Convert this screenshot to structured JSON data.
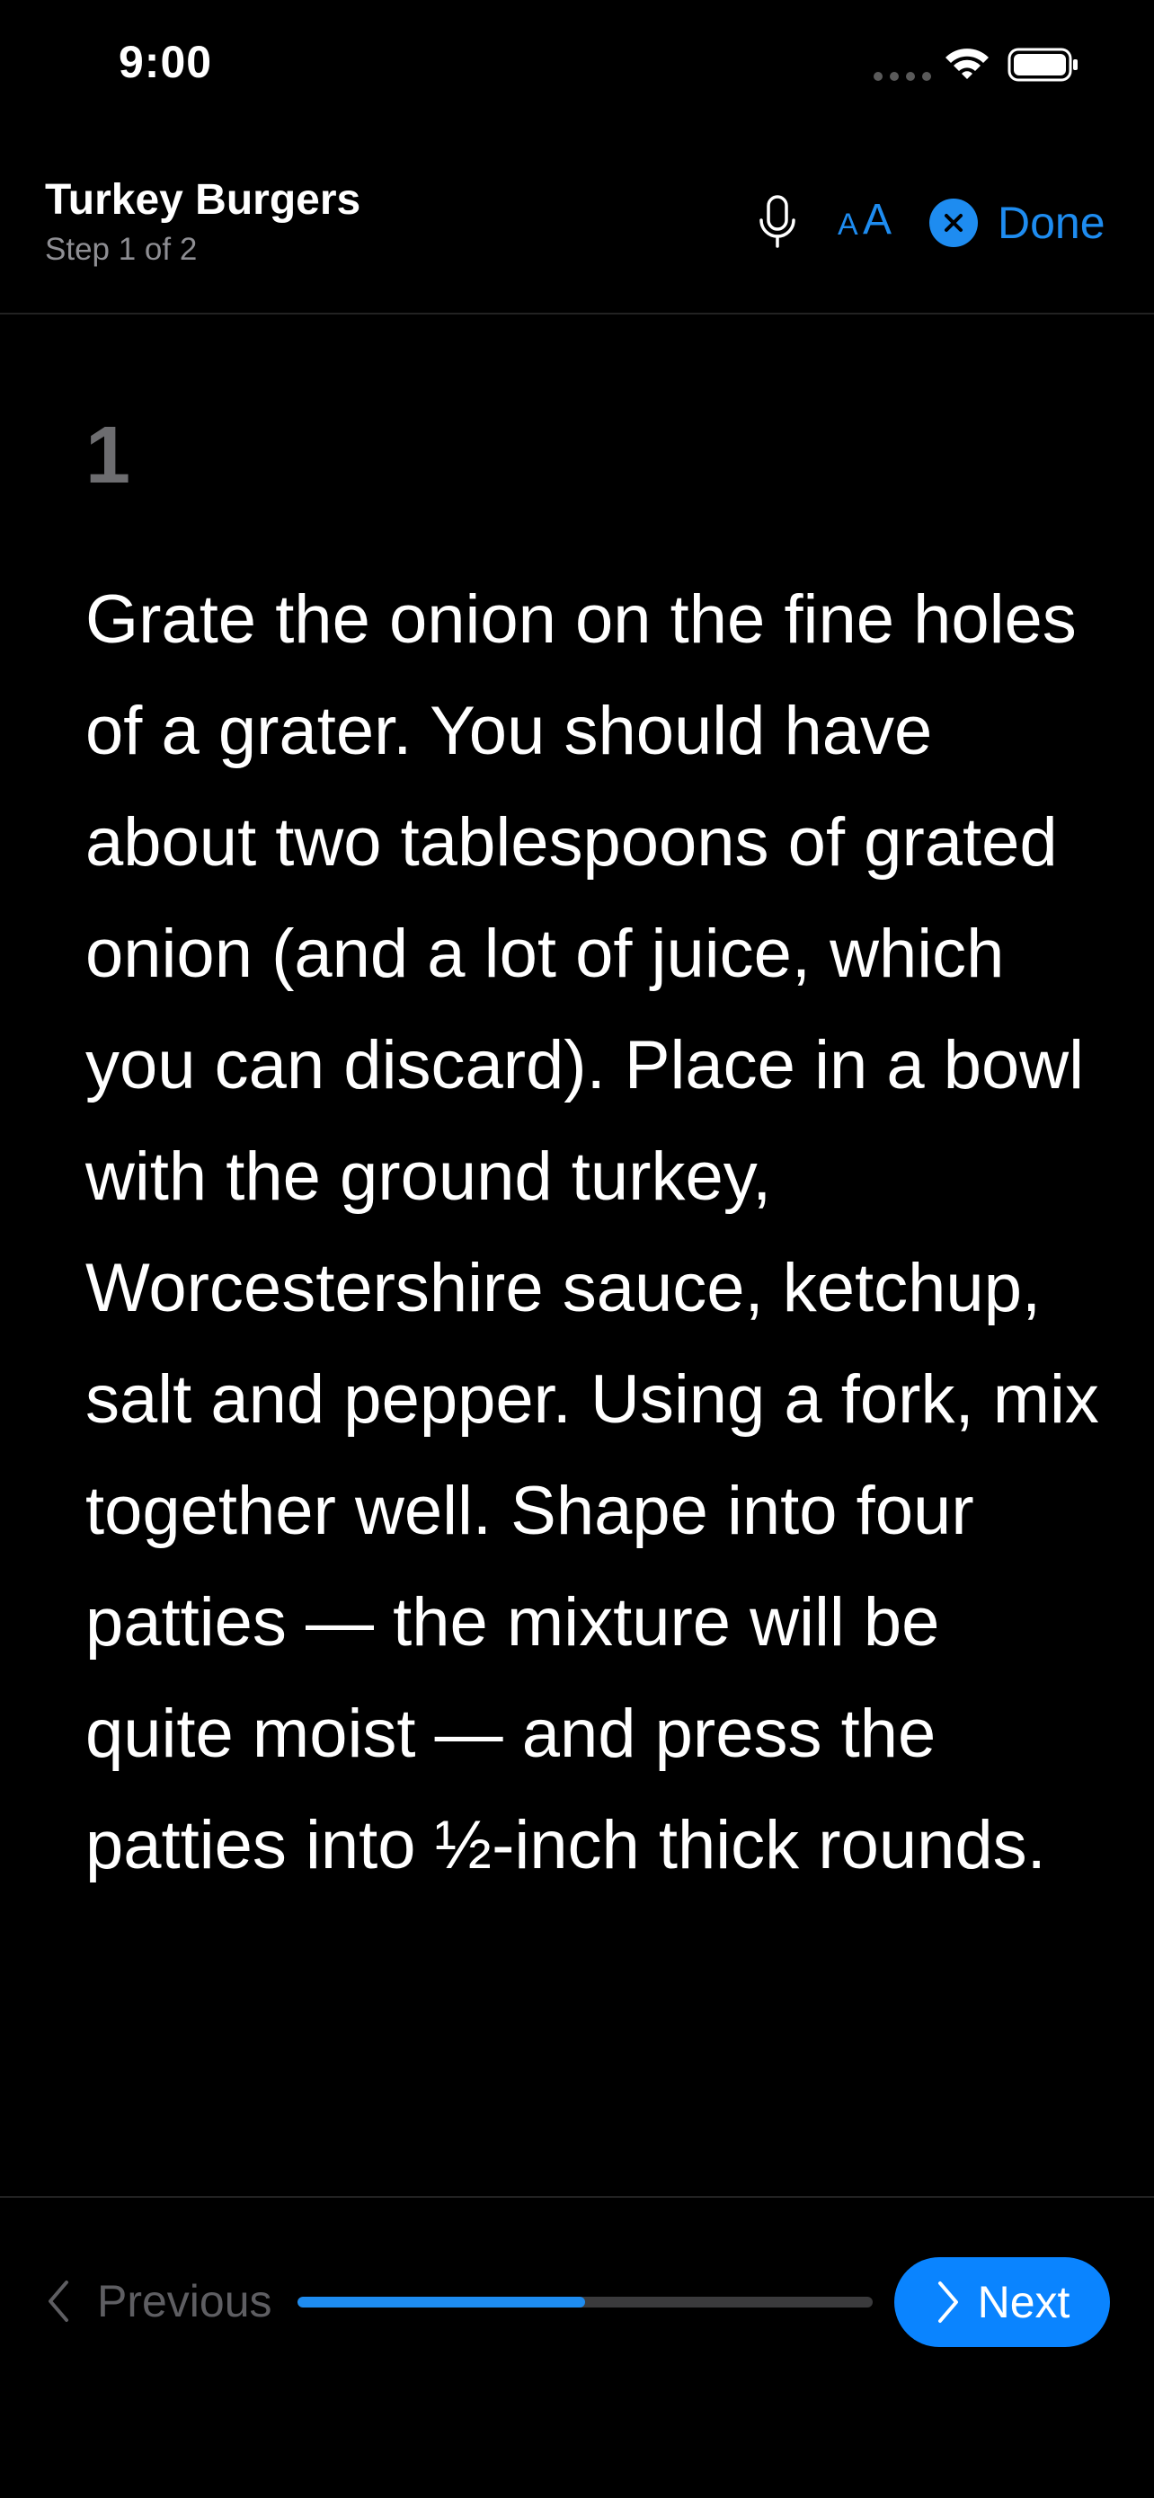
{
  "status_bar": {
    "time": "9:00"
  },
  "header": {
    "title": "Turkey Burgers",
    "subtitle": "Step 1 of 2",
    "text_size_small": "A",
    "text_size_large": "A",
    "done_label": "Done"
  },
  "step": {
    "number": "1",
    "text": "Grate the onion on the fine holes of a grater. You should have about two tablespoons of grated onion (and a lot of juice, which you can discard). Place in a bowl with the ground turkey, Worcestershire sauce, ketchup, salt and pepper. Using a fork, mix together well. Shape into four patties — the mixture will be quite moist — and press the patties into ½-inch thick rounds."
  },
  "footer": {
    "previous_label": "Previous",
    "next_label": "Next",
    "progress": 0.5
  },
  "colors": {
    "accent": "#1e8cf0",
    "next_button": "#0a84ff",
    "disabled": "#5e5e62",
    "background": "#000000"
  },
  "icons": [
    "microphone-icon",
    "text-size-icon",
    "close-circle-icon",
    "chevron-left-icon",
    "chevron-right-icon",
    "wifi-icon",
    "battery-icon",
    "signal-icon"
  ]
}
